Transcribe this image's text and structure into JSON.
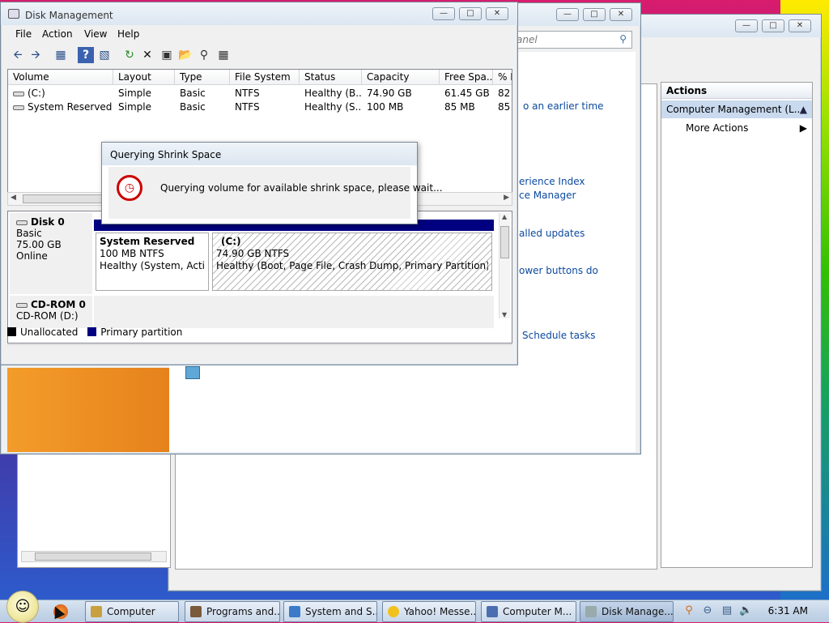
{
  "computer_management": {
    "actions_header": "Actions",
    "actions_item": "Computer Management (L...",
    "more_actions": "More Actions"
  },
  "control_panel": {
    "search_placeholder": "anel",
    "links": [
      "o an earlier time",
      "erience Index",
      "ce Manager",
      "alled updates",
      "ower buttons do",
      "Schedule tasks"
    ]
  },
  "disk_management": {
    "title": "Disk Management",
    "menu": [
      "File",
      "Action",
      "View",
      "Help"
    ],
    "columns": [
      "Volume",
      "Layout",
      "Type",
      "File System",
      "Status",
      "Capacity",
      "Free Spa...",
      "% F"
    ],
    "rows": [
      [
        "(C:)",
        "Simple",
        "Basic",
        "NTFS",
        "Healthy (B...",
        "74.90 GB",
        "61.45 GB",
        "82"
      ],
      [
        "System Reserved",
        "Simple",
        "Basic",
        "NTFS",
        "Healthy (S...",
        "100 MB",
        "85 MB",
        "85"
      ]
    ],
    "disk0": {
      "name": "Disk 0",
      "type": "Basic",
      "size": "75.00 GB",
      "state": "Online",
      "partitions": [
        {
          "name": "System Reserved",
          "size": "100 MB NTFS",
          "status": "Healthy (System, Active,"
        },
        {
          "name": "(C:)",
          "size": "74.90 GB NTFS",
          "status": "Healthy (Boot, Page File, Crash Dump, Primary Partition)"
        }
      ]
    },
    "cdrom": {
      "name": "CD-ROM 0",
      "drive": "CD-ROM (D:)"
    },
    "legend": {
      "unallocated": "Unallocated",
      "primary": "Primary partition"
    },
    "colors": {
      "primary": "#000080",
      "unallocated": "#000000"
    }
  },
  "dialog": {
    "title": "Querying Shrink Space",
    "message": "Querying volume for available shrink space, please wait..."
  },
  "taskbar": {
    "tasks": [
      "Computer",
      "Programs and...",
      "System and S...",
      "Yahoo! Messe...",
      "Computer M...",
      "Disk Manage..."
    ],
    "clock": "6:31 AM"
  }
}
